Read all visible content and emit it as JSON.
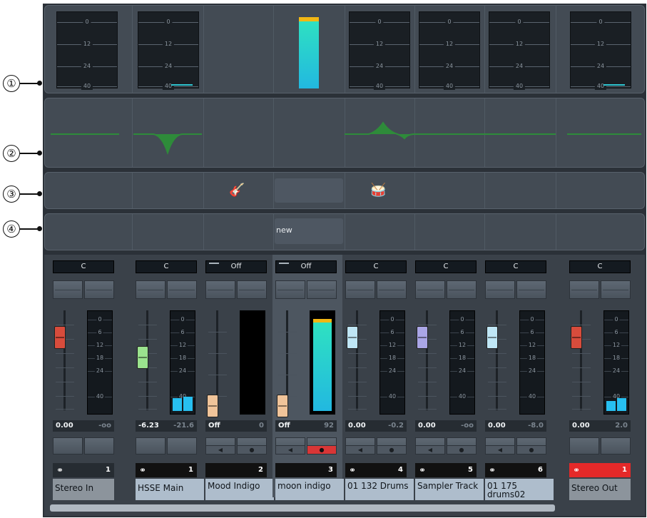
{
  "callouts": [
    "①",
    "②",
    "③",
    "④"
  ],
  "meter_scale": [
    "0",
    "12",
    "24",
    "40"
  ],
  "fader_meter_scale": [
    "0",
    "6",
    "12",
    "18",
    "24",
    "40"
  ],
  "insert_area": {
    "new_label": "new"
  },
  "channels": [
    {
      "pan": "C",
      "volume": "0.00",
      "peak": "-oo",
      "number": "1",
      "name": "Stereo In",
      "fader_color": "#d84c3c"
    },
    {
      "pan": "C",
      "volume": "-6.23",
      "peak": "-21.6",
      "number": "1",
      "name": "HSSE Main",
      "fader_color": "#9be38e"
    },
    {
      "pan": "Off",
      "volume": "Off",
      "peak": "0",
      "number": "2",
      "name": "Mood Indigo",
      "fader_color": "#f0c49a"
    },
    {
      "pan": "Off",
      "volume": "Off",
      "peak": "92",
      "number": "3",
      "name": "moon indigo",
      "fader_color": "#f0c49a"
    },
    {
      "pan": "C",
      "volume": "0.00",
      "peak": "-0.2",
      "number": "4",
      "name": "01 132 Drums",
      "fader_color": "#bfe6f5"
    },
    {
      "pan": "C",
      "volume": "0.00",
      "peak": "-oo",
      "number": "5",
      "name": "Sampler Track",
      "fader_color": "#aaa6e6"
    },
    {
      "pan": "C",
      "volume": "0.00",
      "peak": "-8.0",
      "number": "6",
      "name": "01 175 drums02",
      "fader_color": "#bfe6f5"
    },
    {
      "pan": "C",
      "volume": "0.00",
      "peak": "2.0",
      "number": "1",
      "name": "Stereo Out",
      "fader_color": "#d84c3c"
    }
  ],
  "meter_levels": {
    "ch3_level_fraction": 0.95,
    "ch1_level": "low",
    "out_level": "low"
  },
  "colors": {
    "meter_bar": "#27bff0",
    "peak_indicator": "#f2b714",
    "eq_curve": "#2e8b3a",
    "record_button": "#d93636",
    "output_tag": "#e52929"
  },
  "icons": [
    "guitar-icon",
    "drum-kit-icon",
    "stereo-link-icon",
    "speaker-icon",
    "record-icon"
  ]
}
